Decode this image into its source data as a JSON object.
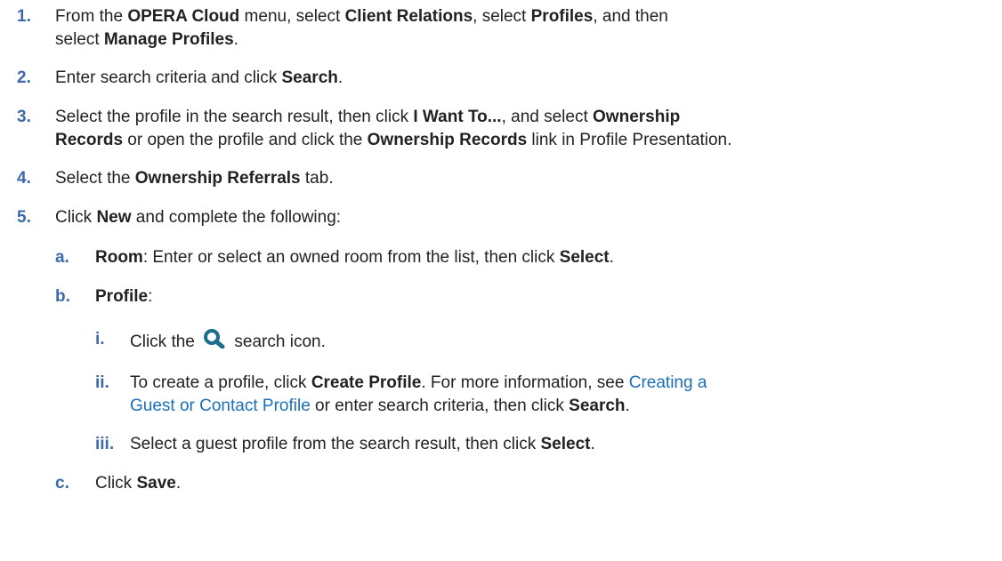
{
  "steps": [
    {
      "num": "1.",
      "line1": {
        "t1": "From the ",
        "b1": "OPERA Cloud",
        "t2": " menu, select ",
        "b2": "Client Relations",
        "t3": ", select ",
        "b3": "Profiles",
        "t4": ", and then"
      },
      "line2": {
        "t1": "select ",
        "b1": "Manage Profiles",
        "t2": "."
      }
    },
    {
      "num": "2.",
      "line1": {
        "t1": "Enter search criteria and click ",
        "b1": "Search",
        "t2": "."
      }
    },
    {
      "num": "3.",
      "line1": {
        "t1": "Select the profile in the search result, then click ",
        "b1": "I Want To...",
        "t2": ", and select ",
        "b2": "Ownership"
      },
      "line2": {
        "b1": "Records",
        "t1": " or open the profile and click the ",
        "b2": "Ownership Records",
        "t2": " link in Profile Presentation."
      }
    },
    {
      "num": "4.",
      "line1": {
        "t1": "Select the ",
        "b1": "Ownership Referrals",
        "t2": " tab."
      }
    },
    {
      "num": "5.",
      "line1": {
        "t1": "Click ",
        "b1": "New",
        "t2": " and complete the following:"
      }
    }
  ],
  "substeps": [
    {
      "num": "a.",
      "line1": {
        "b1": "Room",
        "t1": ": Enter or select an owned room from the list, then click ",
        "b2": "Select",
        "t2": "."
      }
    },
    {
      "num": "b.",
      "line1": {
        "b1": "Profile",
        "t1": ":"
      }
    },
    {
      "num": "c.",
      "line1": {
        "t1": "Click ",
        "b1": "Save",
        "t2": "."
      }
    }
  ],
  "subsubsteps": [
    {
      "num": "i.",
      "line1": {
        "t1": "Click the ",
        "t2": " search icon."
      },
      "icon": "search-icon"
    },
    {
      "num": "ii.",
      "line1": {
        "t1": "To create a profile, click ",
        "b1": "Create Profile",
        "t2": ". For more information, see ",
        "link1": "Creating a"
      },
      "line2": {
        "link1": "Guest or Contact Profile",
        "t1": " or enter search criteria, then click ",
        "b1": "Search",
        "t2": "."
      }
    },
    {
      "num": "iii.",
      "line1": {
        "t1": "Select a guest profile from the search result, then click ",
        "b1": "Select",
        "t2": "."
      }
    }
  ],
  "colors": {
    "number": "#3c6aa8",
    "link": "#1a6fb5",
    "icon": "#1c6e8c",
    "text": "#222222"
  }
}
